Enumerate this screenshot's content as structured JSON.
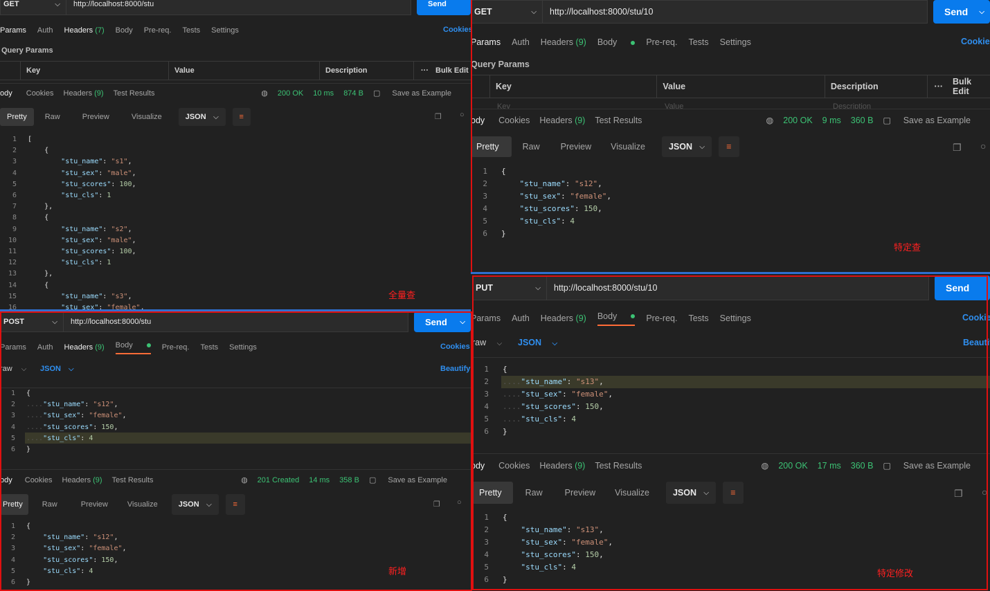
{
  "panels": {
    "getAll": {
      "method": "GET",
      "url": "http://localhost:8000/stu",
      "send": "Send",
      "tabs": [
        "Params",
        "Auth",
        "Headers",
        "(7)",
        "Body",
        "Pre-req.",
        "Tests",
        "Settings"
      ],
      "cookies": "Cookies",
      "query_params": "Query Params",
      "kv_headers": [
        "Key",
        "Value",
        "Description",
        "Bulk Edit"
      ],
      "res_tabs": [
        "ody",
        "Cookies",
        "Headers",
        "(9)",
        "Test Results"
      ],
      "status": "200 OK",
      "time": "10 ms",
      "size": "874 B",
      "save": "Save as Example",
      "view_tabs": [
        "Pretty",
        "Raw",
        "Preview",
        "Visualize"
      ],
      "format": "JSON",
      "label": "全量查"
    },
    "post": {
      "method": "POST",
      "url": "http://localhost:8000/stu",
      "send": "Send",
      "tabs": [
        "Params",
        "Auth",
        "Headers",
        "(9)",
        "Body",
        "Pre-req.",
        "Tests",
        "Settings"
      ],
      "cookies": "Cookies",
      "body_type": "raw",
      "body_format": "JSON",
      "beautify": "Beautify",
      "res_tabs": [
        "ody",
        "Cookies",
        "Headers",
        "(9)",
        "Test Results"
      ],
      "status": "201 Created",
      "time": "14 ms",
      "size": "358 B",
      "save": "Save as Example",
      "view_tabs": [
        "Pretty",
        "Raw",
        "Preview",
        "Visualize"
      ],
      "format": "JSON",
      "label": "新增"
    },
    "getOne": {
      "method": "GET",
      "url": "http://localhost:8000/stu/10",
      "send": "Send",
      "tabs": [
        "Params",
        "Auth",
        "Headers",
        "(9)",
        "Body",
        "Pre-req.",
        "Tests",
        "Settings"
      ],
      "cookies": "Cookie",
      "query_params": "Query Params",
      "kv_headers": [
        "Key",
        "Value",
        "Description",
        "Bulk Edit"
      ],
      "res_tabs": [
        "ody",
        "Cookies",
        "Headers",
        "(9)",
        "Test Results"
      ],
      "status": "200 OK",
      "time": "9 ms",
      "size": "360 B",
      "save": "Save as Example",
      "view_tabs": [
        "Pretty",
        "Raw",
        "Preview",
        "Visualize"
      ],
      "format": "JSON",
      "label": "特定查"
    },
    "put": {
      "method": "PUT",
      "url": "http://localhost:8000/stu/10",
      "send": "Send",
      "tabs": [
        "Params",
        "Auth",
        "Headers",
        "(9)",
        "Body",
        "Pre-req.",
        "Tests",
        "Settings"
      ],
      "cookies": "Cookie",
      "body_type": "raw",
      "body_format": "JSON",
      "beautify": "Beautif",
      "res_tabs": [
        "ody",
        "Cookies",
        "Headers",
        "(9)",
        "Test Results"
      ],
      "status": "200 OK",
      "time": "17 ms",
      "size": "360 B",
      "save": "Save as Example",
      "view_tabs": [
        "Pretty",
        "Raw",
        "Preview",
        "Visualize"
      ],
      "format": "JSON",
      "label": "特定修改"
    }
  },
  "code": {
    "getAll_res": [
      "[",
      "    {",
      "        \"stu_name\": \"s1\",",
      "        \"stu_sex\": \"male\",",
      "        \"stu_scores\": 100,",
      "        \"stu_cls\": 1",
      "    },",
      "    {",
      "        \"stu_name\": \"s2\",",
      "        \"stu_sex\": \"male\",",
      "        \"stu_scores\": 100,",
      "        \"stu_cls\": 1",
      "    },",
      "    {",
      "        \"stu_name\": \"s3\",",
      "        \"stu_sex\": \"female\","
    ],
    "post_req": [
      "{",
      "....\"stu_name\": \"s12\",",
      "....\"stu_sex\": \"female\",",
      "....\"stu_scores\": 150,",
      "....\"stu_cls\": 4",
      "}"
    ],
    "post_res": [
      "{",
      "    \"stu_name\": \"s12\",",
      "    \"stu_sex\": \"female\",",
      "    \"stu_scores\": 150,",
      "    \"stu_cls\": 4",
      "}"
    ],
    "getOne_res": [
      "{",
      "    \"stu_name\": \"s12\",",
      "    \"stu_sex\": \"female\",",
      "    \"stu_scores\": 150,",
      "    \"stu_cls\": 4",
      "}"
    ],
    "put_req": [
      "{",
      "....\"stu_name\": \"s13\",",
      "....\"stu_sex\": \"female\",",
      "....\"stu_scores\": 150,",
      "....\"stu_cls\": 4",
      "}"
    ],
    "put_res": [
      "{",
      "    \"stu_name\": \"s13\",",
      "    \"stu_sex\": \"female\",",
      "    \"stu_scores\": 150,",
      "    \"stu_cls\": 4",
      "}"
    ]
  },
  "kv_placeholders": [
    "Key",
    "Value",
    "Description"
  ]
}
